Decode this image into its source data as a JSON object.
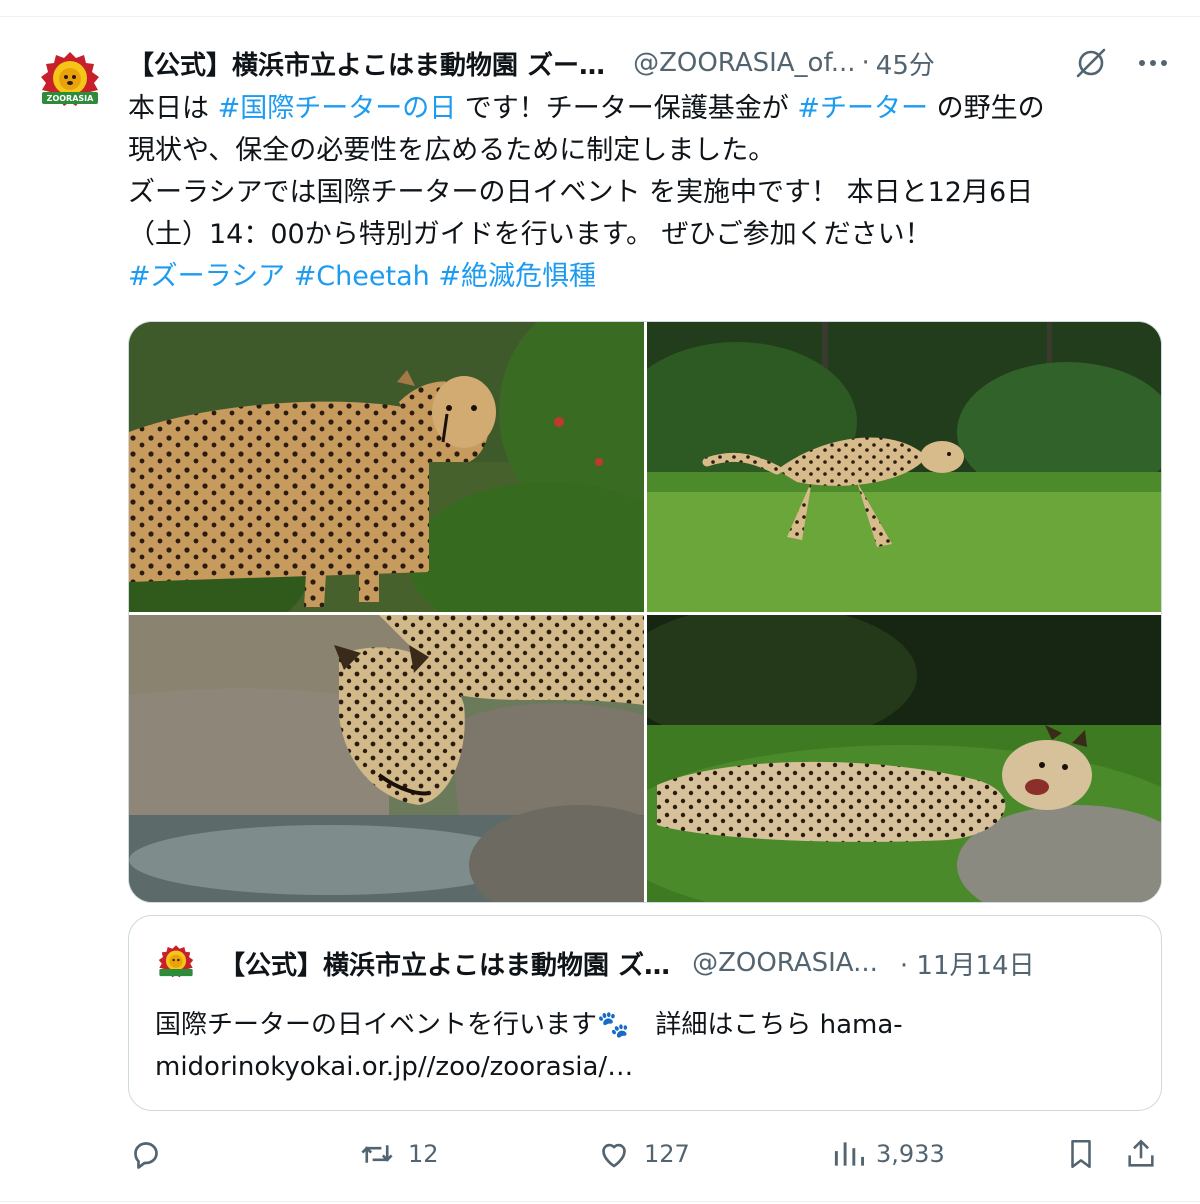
{
  "tweet": {
    "display_name": "【公式】横浜市立よこはま動物園 ズー…",
    "handle": "@ZOORASIA_of...",
    "separator": "·",
    "time_ago": "45分",
    "avatar_label": "ZOORASIA",
    "text_lines": [
      [
        {
          "t": "本日は ",
          "h": false
        },
        {
          "t": "#国際チーターの日",
          "h": true
        },
        {
          "t": " です！チーター保護基金が ",
          "h": false
        },
        {
          "t": "#チーター",
          "h": true
        },
        {
          "t": " の野生の",
          "h": false
        }
      ],
      [
        {
          "t": "現状や、保全の必要性を広めるために制定しました。",
          "h": false
        }
      ],
      [
        {
          "t": "ズーラシアでは国際チーターの日イベント を実施中です！ 本日と12月6日",
          "h": false
        }
      ],
      [
        {
          "t": "（土）14：00から特別ガイドを行います。 ぜひご参加ください！",
          "h": false
        }
      ],
      [
        {
          "t": "#ズーラシア",
          "h": true
        },
        {
          "t": " ",
          "h": false
        },
        {
          "t": "#Cheetah",
          "h": true
        },
        {
          "t": " ",
          "h": false
        },
        {
          "t": "#絶滅危惧種",
          "h": true
        }
      ]
    ]
  },
  "media": {
    "count": 4,
    "subjects": [
      "cheetah-standing",
      "cheetah-running",
      "cheetah-drinking",
      "cheetah-lying"
    ]
  },
  "quote": {
    "display_name": "【公式】横浜市立よこはま動物園 ズ…",
    "handle": "@ZOORASIA...",
    "date": "· 11月14日",
    "text_line1": "国際チーターの日イベントを行います🐾　詳細はこちら hama-",
    "text_line2": "midorinokyokai.or.jp//zoo/zoorasia/…"
  },
  "actions": {
    "reply_count": "",
    "retweet_count": "12",
    "like_count": "127",
    "views_count": "3,933"
  },
  "colors": {
    "accent": "#1d9bf0",
    "secondary_text": "#536471",
    "border": "#cfd9de",
    "logo_red": "#c8202a",
    "logo_yellow": "#f5c518",
    "logo_green": "#2e8b3a"
  }
}
